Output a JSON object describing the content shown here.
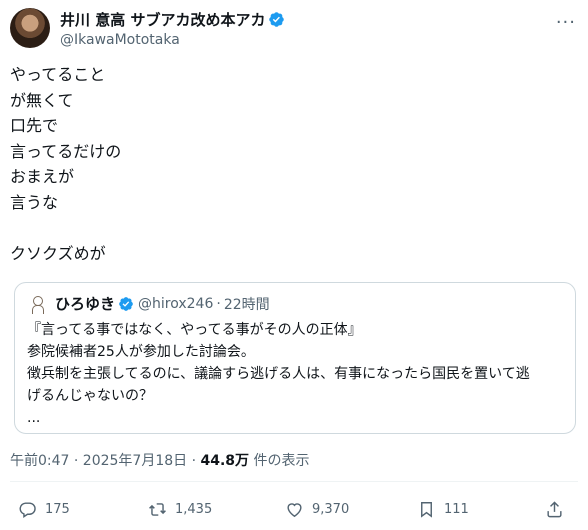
{
  "author": {
    "name": "井川 意高 サブアカ改め本アカ",
    "handle": "@IkawaMototaka"
  },
  "tweet": {
    "text": "やってること\nが無くて\n口先で\n言ってるだけの\nおまえが\n言うな\n\nクソクズめが"
  },
  "quote": {
    "name": "ひろゆき",
    "handle": "@hirox246",
    "separator": "·",
    "time": "22時間",
    "lines": [
      "『言ってる事ではなく、やってる事がその人の正体』",
      "参院候補者25人が参加した討論会。",
      "徴兵制を主張してるのに、議論すら逃げる人は、有事になったら国民を置いて逃",
      "げるんじゃないの？",
      "..."
    ]
  },
  "meta": {
    "timestamp": "午前0:47 · 2025年7月18日 · ",
    "views": "44.8万",
    "views_label": " 件の表示"
  },
  "actions": {
    "replies": "175",
    "retweets": "1,435",
    "likes": "9,370",
    "bookmarks": "111"
  },
  "colors": {
    "verified": "#1d9bf0",
    "secondary_text": "#536471",
    "border": "#cfd9de"
  },
  "icons": [
    "verified-badge-icon",
    "more-icon",
    "reply-icon",
    "retweet-icon",
    "like-icon",
    "bookmark-icon",
    "share-icon"
  ]
}
